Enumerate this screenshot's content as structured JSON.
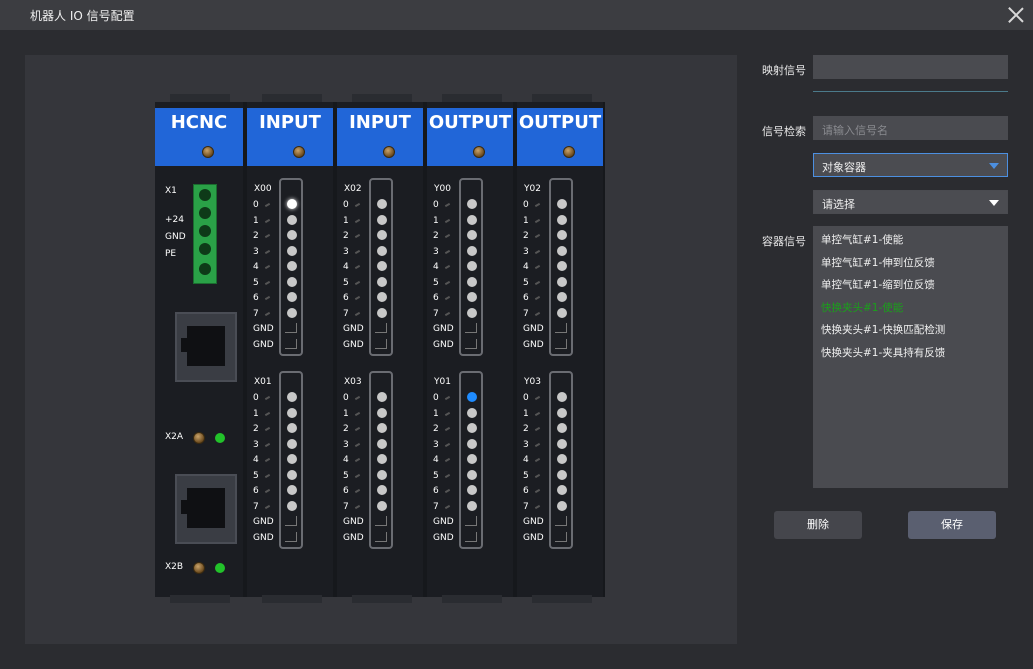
{
  "window": {
    "title": "机器人 IO 信号配置"
  },
  "modules": [
    {
      "name": "HCNC"
    },
    {
      "name": "INPUT",
      "groups": [
        "X00",
        "X01"
      ]
    },
    {
      "name": "INPUT",
      "groups": [
        "X02",
        "X03"
      ]
    },
    {
      "name": "OUTPUT",
      "groups": [
        "Y00",
        "Y01"
      ]
    },
    {
      "name": "OUTPUT",
      "groups": [
        "Y02",
        "Y03"
      ]
    }
  ],
  "hcnc": {
    "x1": "X1",
    "plus24": "+24",
    "gnd": "GND",
    "pe": "PE",
    "x2a": "X2A",
    "x2b": "X2B"
  },
  "pins": [
    "0",
    "1",
    "2",
    "3",
    "4",
    "5",
    "6",
    "7",
    "GND",
    "GND"
  ],
  "active_leds": {
    "X00": 0,
    "Y01": 0
  },
  "led_colors": {
    "white": "#ffffff",
    "blue": "#1e8bff",
    "green": "#22c22a",
    "amber": "#a57b2c"
  },
  "form": {
    "mapping_label": "映射信号",
    "mapping_value": "",
    "search_label": "信号检索",
    "search_placeholder": "请输入信号名",
    "object_select": "对象容器",
    "second_select": "请选择",
    "container_label": "容器信号",
    "signals": [
      "单控气缸#1-使能",
      "单控气缸#1-伸到位反馈",
      "单控气缸#1-缩到位反馈",
      "快换夹头#1-使能",
      "快换夹头#1-快换匹配检测",
      "快换夹头#1-夹具持有反馈"
    ],
    "highlighted_index": 3,
    "delete_label": "删除",
    "save_label": "保存"
  }
}
